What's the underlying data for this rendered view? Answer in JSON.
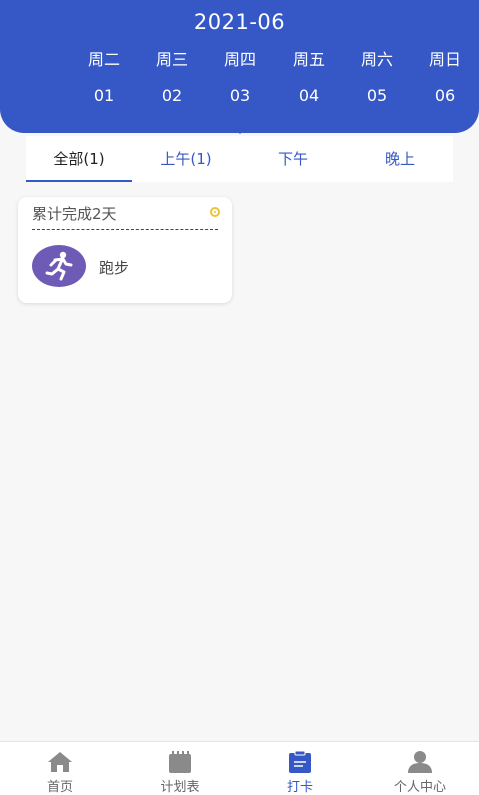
{
  "header": {
    "month": "2021-06",
    "days": [
      {
        "weekday": "周二",
        "date": "01"
      },
      {
        "weekday": "周三",
        "date": "02"
      },
      {
        "weekday": "周四",
        "date": "03"
      },
      {
        "weekday": "周五",
        "date": "04"
      },
      {
        "weekday": "周六",
        "date": "05"
      },
      {
        "weekday": "周日",
        "date": "06"
      }
    ],
    "selected_date": "03"
  },
  "tabs": [
    {
      "label": "全部(1)",
      "active": true
    },
    {
      "label": "上午(1)",
      "active": false
    },
    {
      "label": "下午",
      "active": false
    },
    {
      "label": "晚上",
      "active": false
    }
  ],
  "card": {
    "title": "累计完成2天",
    "item": "跑步",
    "icon": "running-person-icon",
    "status_icon": "yellow-dot-icon"
  },
  "bottom_nav": [
    {
      "label": "首页",
      "icon": "home-icon",
      "active": false
    },
    {
      "label": "计划表",
      "icon": "calendar-icon",
      "active": false
    },
    {
      "label": "打卡",
      "icon": "clipboard-icon",
      "active": true
    },
    {
      "label": "个人中心",
      "icon": "person-icon",
      "active": false
    }
  ],
  "colors": {
    "primary": "#3558c6",
    "card_icon_bg": "#6e5bb5",
    "status_dot": "#f1c232",
    "background": "#f7f7f7"
  }
}
